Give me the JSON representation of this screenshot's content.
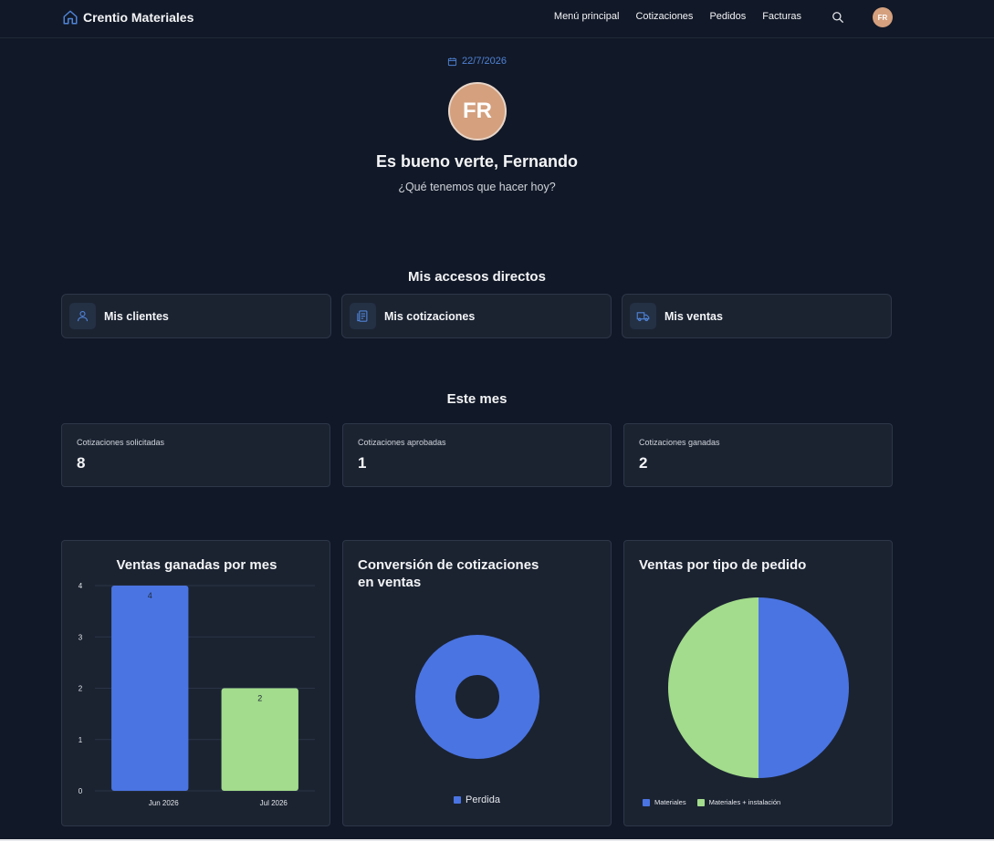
{
  "navbar": {
    "brand": "Crentio Materiales",
    "links": [
      "Menú principal",
      "Cotizaciones",
      "Pedidos",
      "Facturas"
    ],
    "avatar_initials": "FR"
  },
  "hero": {
    "date": "22/7/2026",
    "avatar_initials": "FR",
    "greeting": "Es bueno verte, Fernando",
    "subtitle": "¿Qué tenemos que hacer hoy?"
  },
  "shortcuts": {
    "title": "Mis accesos directos",
    "items": [
      {
        "label": "Mis clientes",
        "icon": "user-icon"
      },
      {
        "label": "Mis cotizaciones",
        "icon": "document-icon"
      },
      {
        "label": "Mis ventas",
        "icon": "truck-icon"
      }
    ]
  },
  "month": {
    "title": "Este mes",
    "stats": [
      {
        "label": "Cotizaciones solicitadas",
        "value": "8"
      },
      {
        "label": "Cotizaciones aprobadas",
        "value": "1"
      },
      {
        "label": "Cotizaciones ganadas",
        "value": "2"
      }
    ]
  },
  "colors": {
    "accent": "#4f83d6",
    "blue": "#4a74e2",
    "green": "#a3dc8c",
    "avatar": "#d4a07e"
  },
  "chart_data": [
    {
      "type": "bar",
      "title": "Ventas ganadas por mes",
      "categories": [
        "Jun 2026",
        "Jul 2026"
      ],
      "values": [
        4,
        2
      ],
      "colors": [
        "#4a74e2",
        "#a3dc8c"
      ],
      "yticks": [
        0,
        1,
        2,
        3,
        4
      ],
      "ylim": [
        0,
        4
      ],
      "grid": true
    },
    {
      "type": "pie",
      "title": "Conversión de cotizaciones en ventas",
      "variant": "doughnut",
      "labels": [
        "Perdida"
      ],
      "values": [
        1
      ],
      "colors": [
        "#4a74e2"
      ],
      "legend": "bottom"
    },
    {
      "type": "pie",
      "title": "Ventas por tipo de pedido",
      "labels": [
        "Materiales",
        "Materiales + instalación"
      ],
      "values": [
        1,
        1
      ],
      "colors": [
        "#4a74e2",
        "#a3dc8c"
      ],
      "legend": "bottom"
    }
  ]
}
